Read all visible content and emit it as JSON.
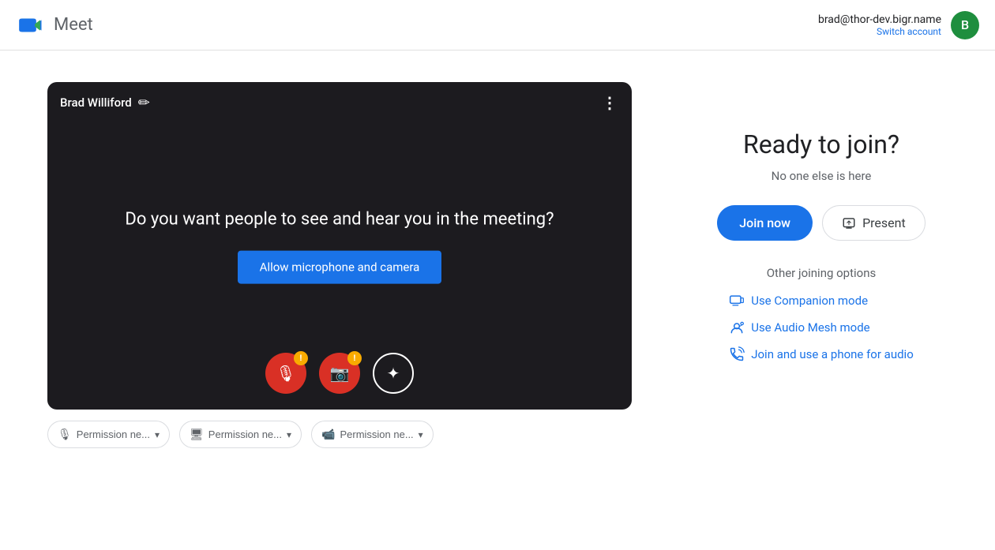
{
  "header": {
    "app_name": "Meet",
    "user_email": "brad@thor-dev.bigr.name",
    "switch_account_label": "Switch account",
    "avatar_letter": "B"
  },
  "video_preview": {
    "user_name": "Brad Williford",
    "question_text": "Do you want people to see and hear you in the meeting?",
    "allow_btn_label": "Allow microphone and camera"
  },
  "permissions": {
    "microphone_label": "Permission ne...",
    "screen_label": "Permission ne...",
    "camera_label": "Permission ne..."
  },
  "right_panel": {
    "ready_title": "Ready to join?",
    "no_one_text": "No one else is here",
    "join_now_label": "Join now",
    "present_label": "Present",
    "other_options_title": "Other joining options",
    "companion_mode_label": "Use Companion mode",
    "audio_mesh_label": "Use Audio Mesh mode",
    "phone_audio_label": "Join and use a phone for audio"
  }
}
